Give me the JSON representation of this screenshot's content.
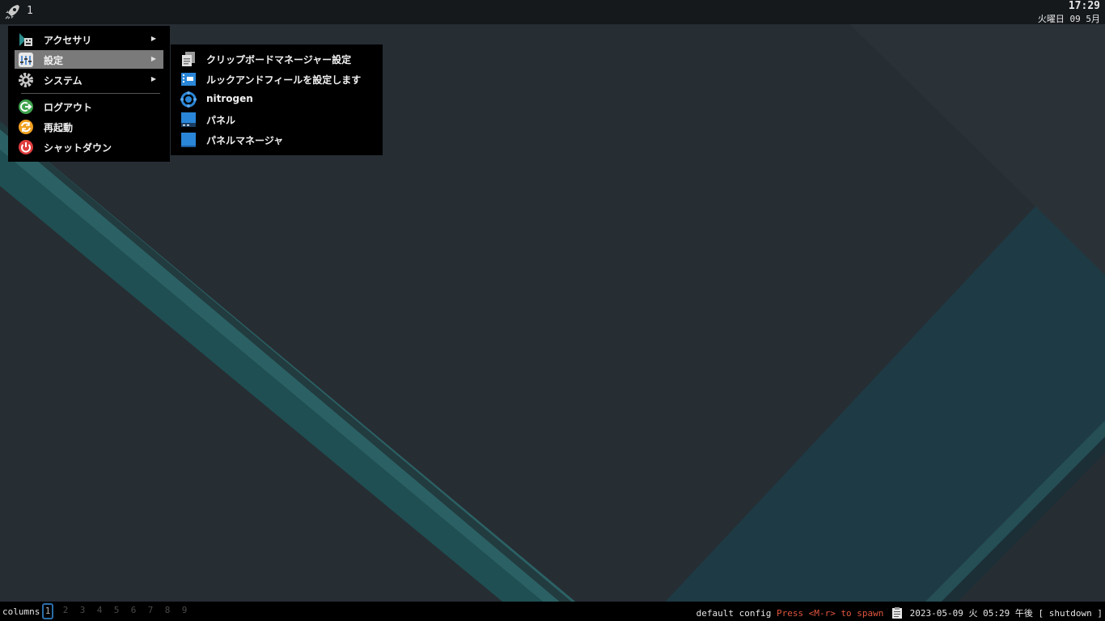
{
  "topbar": {
    "workspace": "1",
    "clock_time": "17:29",
    "clock_date": "火曜日 09 5月"
  },
  "menu": {
    "items": [
      {
        "label": "アクセサリ",
        "icon": "accessories-icon",
        "has_submenu": true
      },
      {
        "label": "設定",
        "icon": "settings-icon",
        "has_submenu": true,
        "active": true
      },
      {
        "label": "システム",
        "icon": "system-gear-icon",
        "has_submenu": true
      },
      {
        "label": "ログアウト",
        "icon": "logout-icon",
        "has_submenu": false
      },
      {
        "label": "再起動",
        "icon": "reboot-icon",
        "has_submenu": false
      },
      {
        "label": "シャットダウン",
        "icon": "shutdown-icon",
        "has_submenu": false
      }
    ],
    "arrow": "▶"
  },
  "submenu": {
    "items": [
      {
        "label": "クリップボードマネージャー設定",
        "icon": "clipboard-manager-icon"
      },
      {
        "label": "ルックアンドフィールを設定します",
        "icon": "appearance-icon"
      },
      {
        "label": "nitrogen",
        "icon": "nitrogen-icon"
      },
      {
        "label": "パネル",
        "icon": "panel-icon"
      },
      {
        "label": "パネルマネージャ",
        "icon": "panel-manager-icon"
      }
    ]
  },
  "bottombar": {
    "layout": "columns",
    "tags": [
      "1",
      "2",
      "3",
      "4",
      "5",
      "6",
      "7",
      "8",
      "9"
    ],
    "active_tag": "1",
    "config_text": "default config",
    "hint_text": "Press <M-r> to spawn",
    "datetime": "2023-05-09 火 05:29 午後",
    "shutdown": "[ shutdown ]"
  },
  "colors": {
    "hint": "#e0553f",
    "active_tag_border": "#2c6ea8",
    "menu_highlight": "#7a7a7a",
    "teal_stripe": "#2b5f62"
  }
}
